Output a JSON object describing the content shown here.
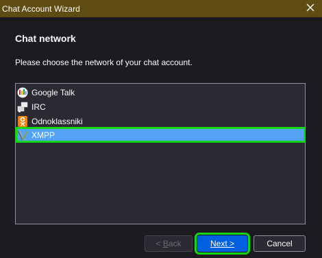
{
  "window": {
    "title": "Chat Account Wizard",
    "close_icon": "close-icon"
  },
  "page": {
    "title": "Chat network",
    "description": "Please choose the network of your chat account."
  },
  "networks": [
    {
      "label": "Google Talk",
      "icon": "google-talk-icon",
      "selected": false
    },
    {
      "label": "IRC",
      "icon": "irc-icon",
      "selected": false
    },
    {
      "label": "Odnoklassniki",
      "icon": "odnoklassniki-icon",
      "selected": false
    },
    {
      "label": "XMPP",
      "icon": "xmpp-icon",
      "selected": true
    }
  ],
  "buttons": {
    "back": {
      "prefix": "< ",
      "accel": "B",
      "rest": "ack",
      "enabled": false
    },
    "next": {
      "accel": "N",
      "rest": "ext >",
      "enabled": true
    },
    "cancel": {
      "label": "Cancel",
      "enabled": true
    }
  },
  "colors": {
    "titlebar": "#5f4c13",
    "selection": "#54a3f5",
    "highlight_outline": "#14d714",
    "primary_button": "#0060df"
  }
}
